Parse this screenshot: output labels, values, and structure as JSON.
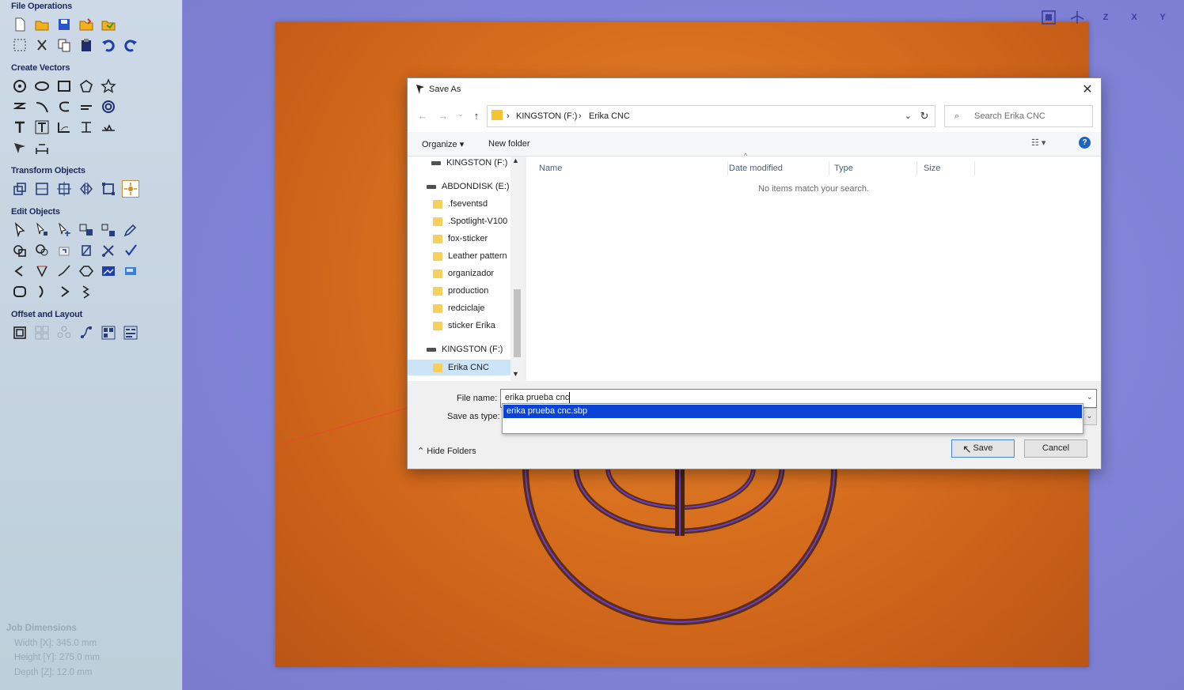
{
  "toolpanel": {
    "sections": {
      "file_ops": "File Operations",
      "create_vectors": "Create Vectors",
      "transform": "Transform Objects",
      "edit": "Edit Objects",
      "offset": "Offset and Layout"
    },
    "job": {
      "title": "Job Dimensions",
      "width": "Width  [X]: 345.0 mm",
      "height": "Height [Y]: 275.0 mm",
      "depth": "Depth  [Z]: 12.0 mm"
    }
  },
  "view": {
    "icons": [
      "view-3d-icon",
      "iso-view-icon",
      "z-view-icon",
      "x-view-icon",
      "y-view-icon"
    ],
    "axis_labels": [
      "Z",
      "X",
      "Y"
    ]
  },
  "dialog": {
    "title": "Save As",
    "address": {
      "drive": "KINGSTON (F:)",
      "folder": "Erika CNC"
    },
    "search_placeholder": "Search Erika CNC",
    "commands": {
      "organize": "Organize",
      "new_folder": "New folder"
    },
    "tree": [
      {
        "label": "KINGSTON (F:)",
        "kind": "drive"
      },
      {
        "label": "ABDONDISK (E:)",
        "kind": "drive"
      },
      {
        "label": ".fseventsd",
        "kind": "folder"
      },
      {
        "label": ".Spotlight-V100",
        "kind": "folder"
      },
      {
        "label": "fox-sticker",
        "kind": "folder"
      },
      {
        "label": "Leather pattern",
        "kind": "folder"
      },
      {
        "label": "organizador",
        "kind": "folder"
      },
      {
        "label": "production",
        "kind": "folder"
      },
      {
        "label": "redciclaje",
        "kind": "folder"
      },
      {
        "label": "sticker Erika",
        "kind": "folder"
      },
      {
        "label": "KINGSTON (F:)",
        "kind": "drive"
      },
      {
        "label": "Erika CNC",
        "kind": "folder",
        "selected": true
      }
    ],
    "columns": [
      "Name",
      "Date modified",
      "Type",
      "Size"
    ],
    "empty_message": "No items match your search.",
    "file_name_label": "File name:",
    "file_name_value": "erika prueba cnc",
    "save_type_label": "Save as type:",
    "suggestion": "erika prueba cnc.sbp",
    "hide_folders": "Hide Folders",
    "save": "Save",
    "cancel": "Cancel"
  },
  "colors": {
    "accent": "#0a43d6",
    "material": "#d46a1c",
    "view_bg": "#8a88d8",
    "folder": "#f7d05c"
  }
}
